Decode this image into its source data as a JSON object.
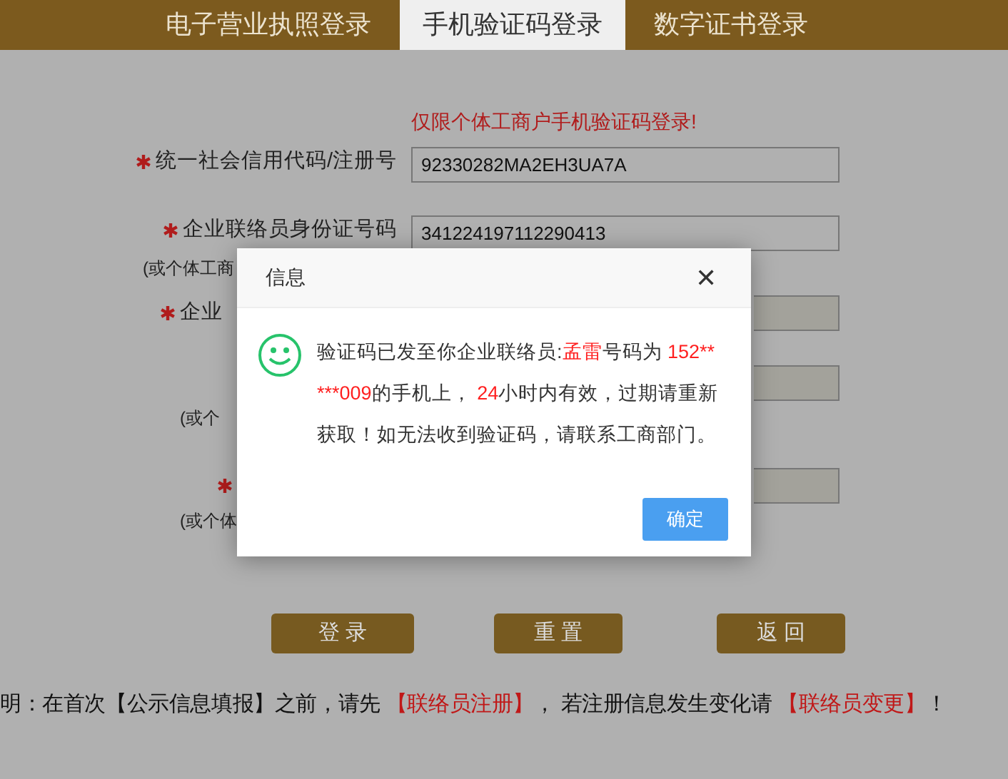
{
  "tabs": [
    {
      "label": "电子营业执照登录",
      "selected": false
    },
    {
      "label": "手机验证码登录",
      "selected": true
    },
    {
      "label": "数字证书登录",
      "selected": false
    }
  ],
  "notice": "仅限个体工商户手机验证码登录!",
  "form": [
    {
      "required": true,
      "label": "统一社会信用代码/注册号",
      "value": "92330282MA2EH3UA7A",
      "disabled": false
    },
    {
      "required": true,
      "label": "企业联络员身份证号码",
      "sublabel": "(或个体工商",
      "value": "341224197112290413",
      "disabled": false
    },
    {
      "required": true,
      "label": "企业",
      "disabled": true
    },
    {
      "required": false,
      "sublabel": "(或个",
      "disabled": true
    },
    {
      "required": true,
      "sublabel": "(或个体",
      "disabled": true
    }
  ],
  "buttons": [
    "登 录",
    "重 置",
    "返 回"
  ],
  "footer": [
    {
      "kind": "text",
      "text": "明：在首次【公示信息填报】之前，请先 "
    },
    {
      "kind": "link",
      "text": "【联络员注册】"
    },
    {
      "kind": "text",
      "text": "， 若注册信息发生变化请 "
    },
    {
      "kind": "link",
      "text": "【联络员变更】"
    },
    {
      "kind": "text",
      "text": "！"
    }
  ],
  "dialog": {
    "title": "信息",
    "close": "✕",
    "message": [
      {
        "kind": "text",
        "text": "验证码已发至你企业联络员:"
      },
      {
        "kind": "highlight",
        "text": "孟雷"
      },
      {
        "kind": "text",
        "text": "号码为 "
      },
      {
        "kind": "highlight",
        "text": "152*****009"
      },
      {
        "kind": "text",
        "text": "的手机上， "
      },
      {
        "kind": "highlight",
        "text": "24"
      },
      {
        "kind": "text",
        "text": "小时内有效，过期请重新获取！如无法收到验证码，请联系工商部门。"
      }
    ],
    "button": "确定"
  }
}
